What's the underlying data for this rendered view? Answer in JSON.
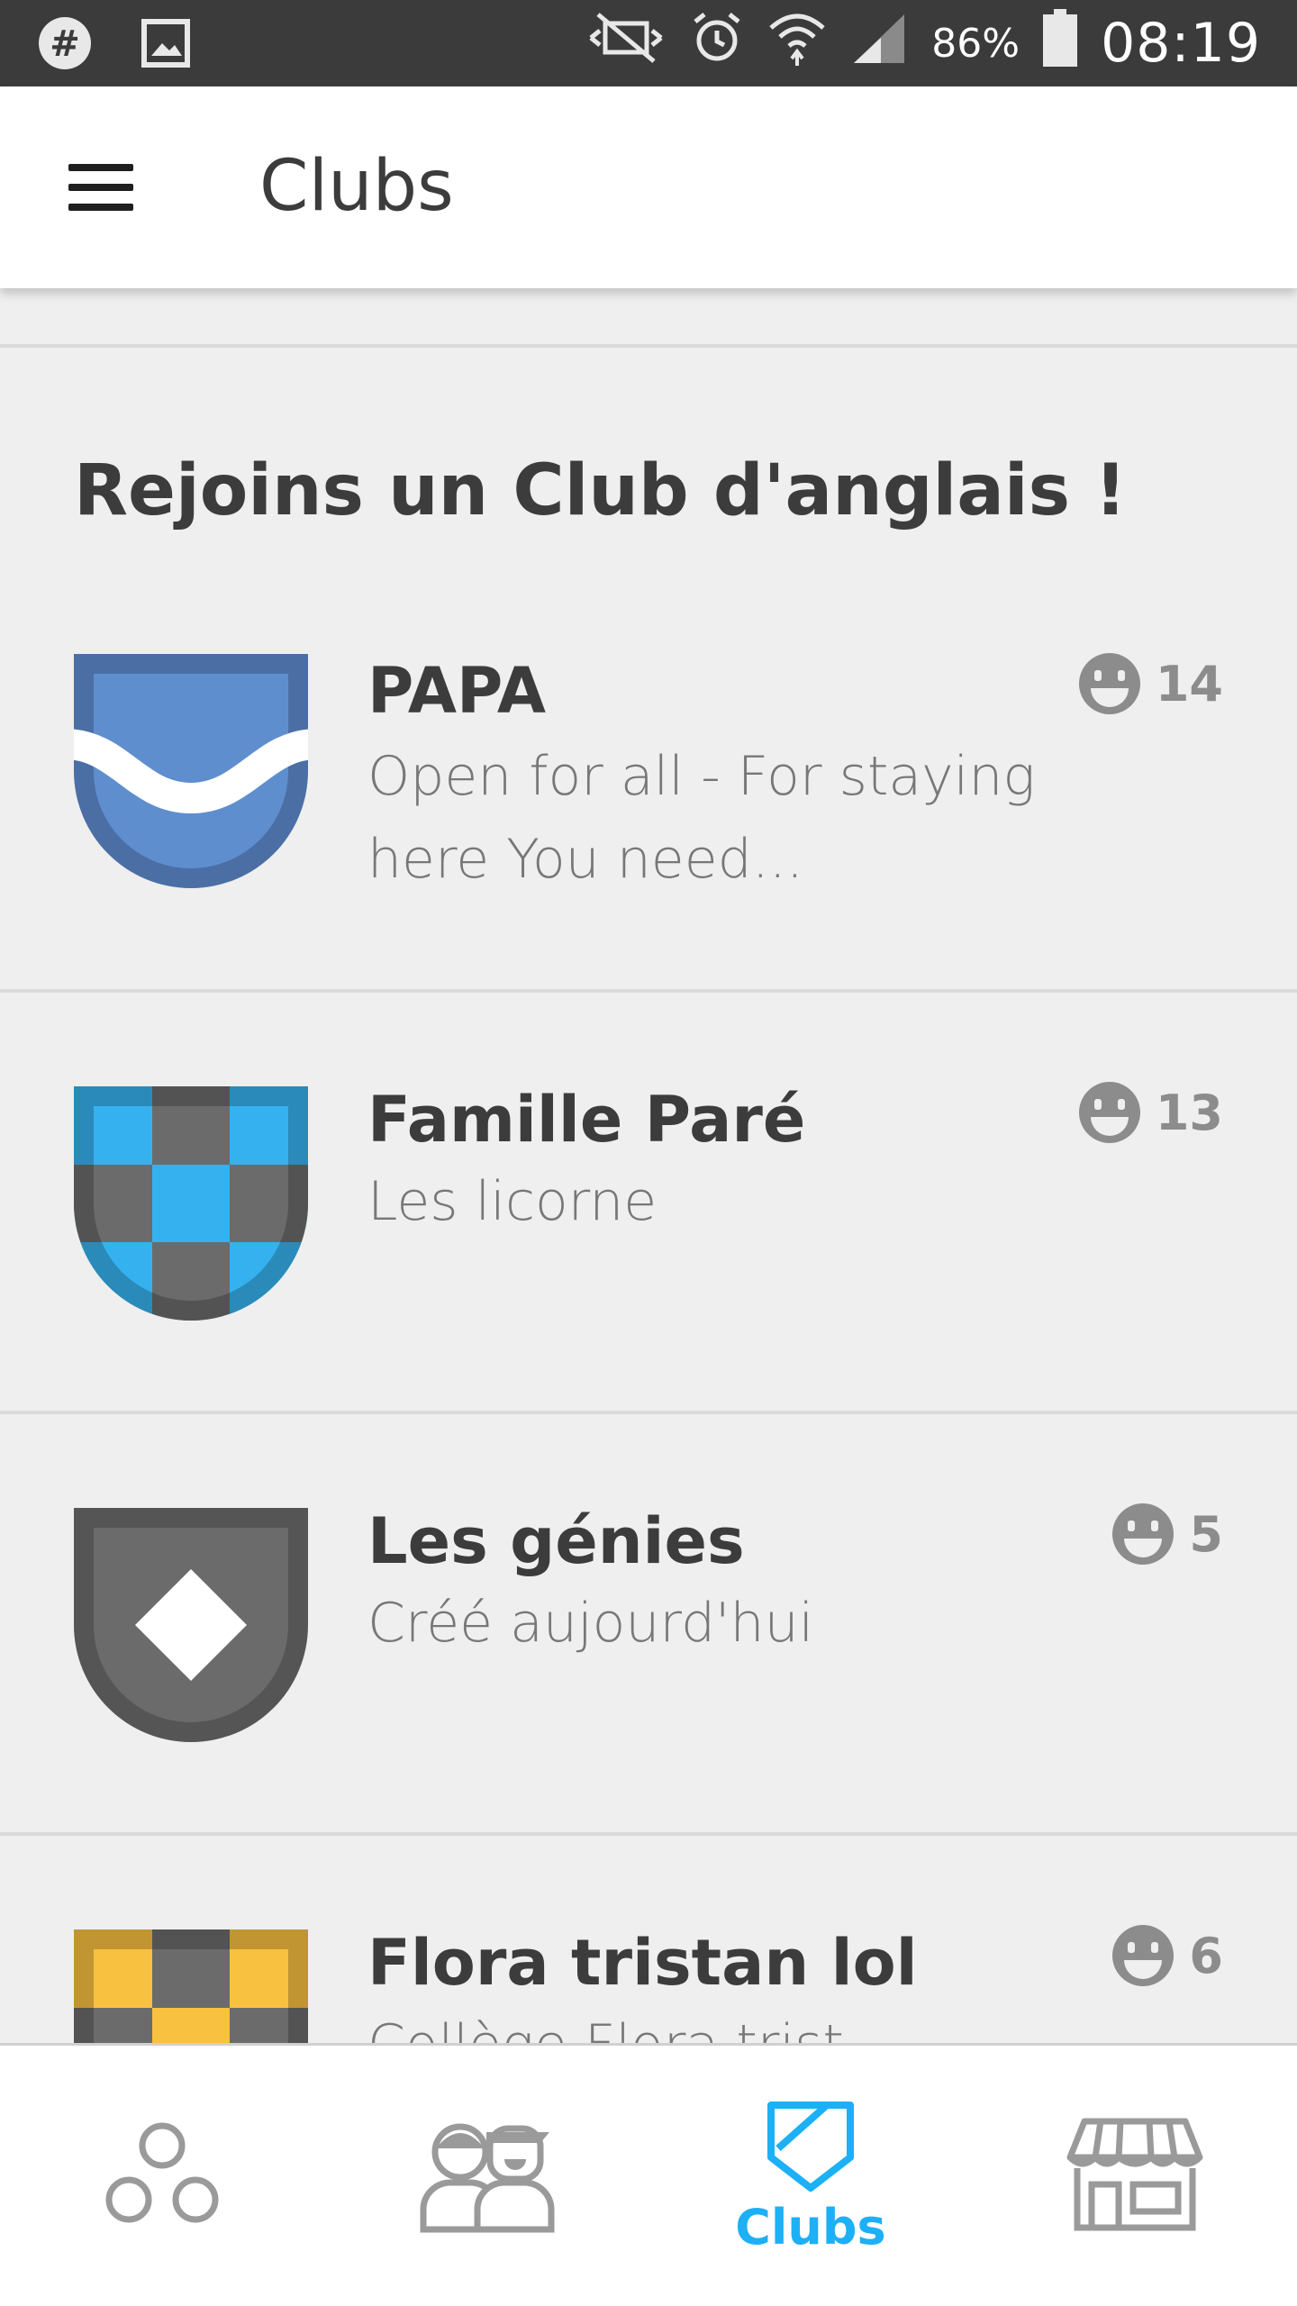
{
  "status_bar": {
    "left_icons": [
      "notification-hash-icon",
      "gallery-icon"
    ],
    "right_icons": [
      "mute-icon",
      "alarm-icon",
      "wifi-icon",
      "signal-icon",
      "battery-icon"
    ],
    "battery_percent": "86%",
    "time": "08:19"
  },
  "app_bar": {
    "title": "Clubs"
  },
  "section": {
    "heading": "Rejoins un Club d'anglais !"
  },
  "clubs": [
    {
      "name": "PAPA",
      "description": "Open for all - For staying here You need...",
      "member_count": "14",
      "shield": "wave-shield"
    },
    {
      "name": "Famille Paré",
      "description": "Les licorne",
      "member_count": "13",
      "shield": "checker-blue-shield"
    },
    {
      "name": "Les génies",
      "description": "Créé aujourd'hui",
      "member_count": "5",
      "shield": "diamond-gray-shield"
    },
    {
      "name": "Flora tristan lol",
      "description": "Collège Flora trist...",
      "member_count": "6",
      "shield": "checker-yellow-shield"
    }
  ],
  "bottom_nav": {
    "items": [
      {
        "icon": "skills-tree-icon",
        "label": ""
      },
      {
        "icon": "friends-icon",
        "label": ""
      },
      {
        "icon": "clubs-shield-icon",
        "label": "Clubs"
      },
      {
        "icon": "shop-icon",
        "label": ""
      }
    ]
  },
  "colors": {
    "accent": "#1cb0f6",
    "background": "#efefef",
    "shield_blue": "#5f8ecf",
    "shield_blue_dark": "#4b6fa5",
    "shield_cyan": "#36b1ef",
    "shield_gray": "#6b6b6b",
    "shield_yellow": "#f8c140"
  }
}
